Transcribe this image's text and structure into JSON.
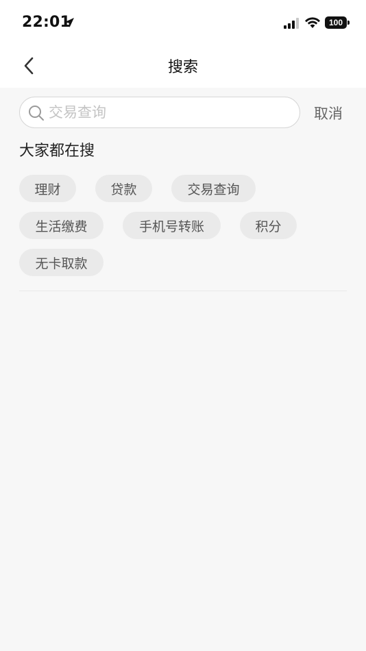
{
  "status_bar": {
    "time": "22:01",
    "battery": "100"
  },
  "nav": {
    "title": "搜索"
  },
  "search": {
    "value": "",
    "placeholder": "交易查询",
    "cancel_label": "取消"
  },
  "hot": {
    "title": "大家都在搜",
    "tags": [
      "理财",
      "贷款",
      "交易查询",
      "生活缴费",
      "手机号转账",
      "积分",
      "无卡取款"
    ]
  },
  "icons": {
    "back": "chevron-left-icon",
    "search": "search-icon",
    "location": "location-arrow-icon",
    "signal": "cellular-signal-icon",
    "wifi": "wifi-icon",
    "battery": "battery-icon"
  }
}
